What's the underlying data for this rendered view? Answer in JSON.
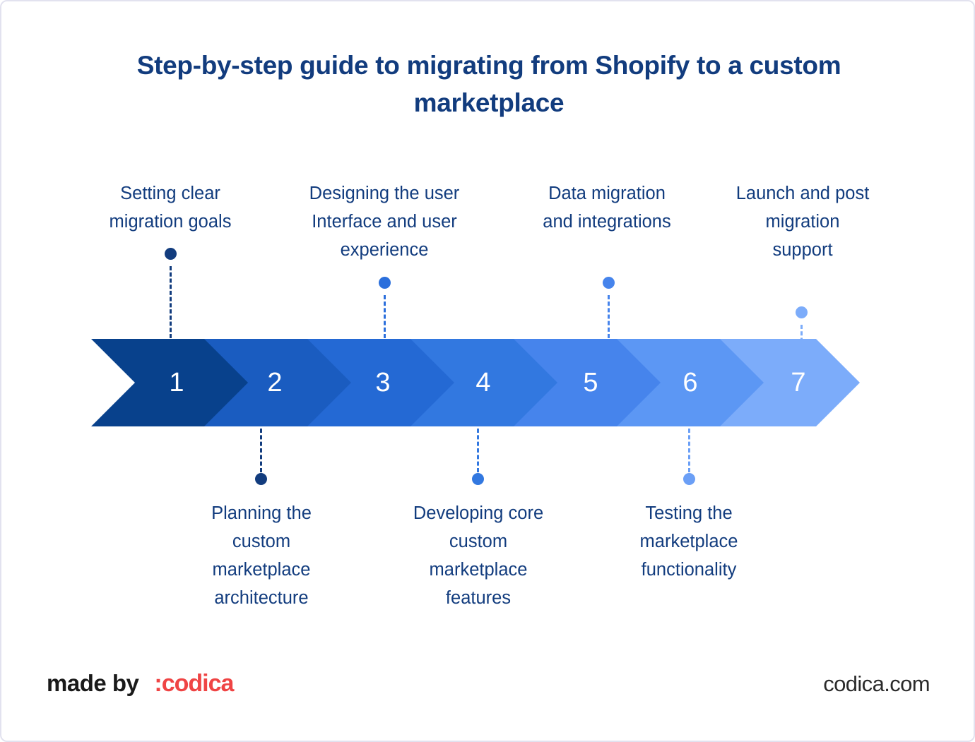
{
  "page": {
    "title": "Step-by-step guide to migrating from Shopify to a custom marketplace",
    "background_color": "#ffffff",
    "border_color": "#e2e2ef",
    "text_color": "#123C7E"
  },
  "timeline": {
    "type": "chevron-process-arrow",
    "steps": [
      {
        "number": "1",
        "label": "Setting clear\nmigration goals",
        "position": "top",
        "color": "#08418C",
        "dot_color": "#123C7E",
        "dash_color": "#123C7E"
      },
      {
        "number": "2",
        "label": "Planning the\ncustom\nmarketplace\narchitecture",
        "position": "bottom",
        "color": "#1A5CC0",
        "dot_color": "#123C7E",
        "dash_color": "#123C7E"
      },
      {
        "number": "3",
        "label": "Designing the user\nInterface and user\nexperience",
        "position": "top",
        "color": "#2469D4",
        "dot_color": "#2B6FDC",
        "dash_color": "#2B6FDC"
      },
      {
        "number": "4",
        "label": "Developing core\ncustom\nmarketplace\nfeatures",
        "position": "bottom",
        "color": "#3278E0",
        "dot_color": "#3278E0",
        "dash_color": "#3278E0"
      },
      {
        "number": "5",
        "label": "Data migration\nand integrations",
        "position": "top",
        "color": "#4684EC",
        "dot_color": "#4684EC",
        "dash_color": "#4684EC"
      },
      {
        "number": "6",
        "label": "Testing the\nmarketplace\nfunctionality",
        "position": "bottom",
        "color": "#5C97F4",
        "dot_color": "#6B9FF6",
        "dash_color": "#6B9FF6"
      },
      {
        "number": "7",
        "label": "Launch and post\nmigration\nsupport",
        "position": "top",
        "color": "#7CACFA",
        "dot_color": "#7CACFA",
        "dash_color": "#7CACFA"
      }
    ]
  },
  "footer": {
    "made_by_label": "made by",
    "brand": ":codica",
    "brand_color": "#EF4444",
    "website": "codica.com"
  }
}
